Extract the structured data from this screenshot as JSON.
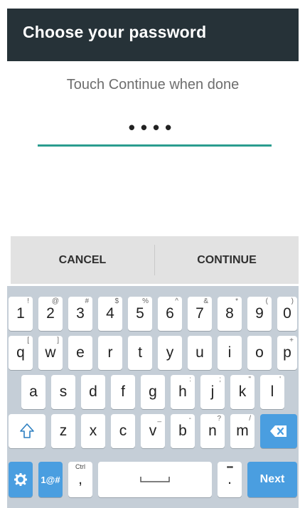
{
  "header": {
    "title": "Choose your password"
  },
  "form": {
    "hint": "Touch Continue when done",
    "masked_value": "••••"
  },
  "buttons": {
    "cancel": "CANCEL",
    "continue": "CONTINUE"
  },
  "keyboard": {
    "row1": [
      {
        "k": "1",
        "s": "!"
      },
      {
        "k": "2",
        "s": "@"
      },
      {
        "k": "3",
        "s": "#"
      },
      {
        "k": "4",
        "s": "$"
      },
      {
        "k": "5",
        "s": "%"
      },
      {
        "k": "6",
        "s": "^"
      },
      {
        "k": "7",
        "s": "&"
      },
      {
        "k": "8",
        "s": "*"
      },
      {
        "k": "9",
        "s": "("
      },
      {
        "k": "0",
        "s": ")"
      }
    ],
    "row2": [
      {
        "k": "q",
        "s": "["
      },
      {
        "k": "w",
        "s": "]"
      },
      {
        "k": "e",
        "s": ""
      },
      {
        "k": "r",
        "s": ""
      },
      {
        "k": "t",
        "s": ""
      },
      {
        "k": "y",
        "s": ""
      },
      {
        "k": "u",
        "s": ""
      },
      {
        "k": "i",
        "s": ""
      },
      {
        "k": "o",
        "s": ""
      },
      {
        "k": "p",
        "s": "+"
      }
    ],
    "row3": [
      {
        "k": "a",
        "s": ""
      },
      {
        "k": "s",
        "s": ""
      },
      {
        "k": "d",
        "s": ""
      },
      {
        "k": "f",
        "s": ""
      },
      {
        "k": "g",
        "s": ""
      },
      {
        "k": "h",
        "s": ":"
      },
      {
        "k": "j",
        "s": ";"
      },
      {
        "k": "k",
        "s": "\""
      },
      {
        "k": "l",
        "s": "'"
      }
    ],
    "row4": [
      {
        "k": "z",
        "s": ""
      },
      {
        "k": "x",
        "s": ""
      },
      {
        "k": "c",
        "s": ""
      },
      {
        "k": "v",
        "s": "_"
      },
      {
        "k": "b",
        "s": "-"
      },
      {
        "k": "n",
        "s": "?"
      },
      {
        "k": "m",
        "s": "/"
      }
    ],
    "symbols_label": "1@#",
    "ctrl_label": "Ctrl",
    "comma": ",",
    "period_sub": "•••",
    "period": ".",
    "next_label": "Next"
  }
}
